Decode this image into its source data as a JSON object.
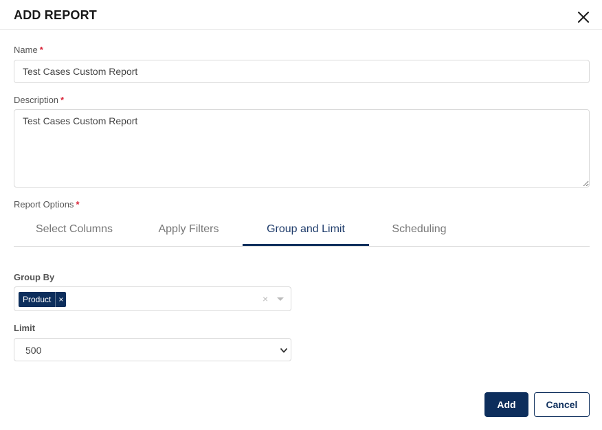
{
  "dialog": {
    "title": "ADD REPORT"
  },
  "form": {
    "name_label": "Name",
    "name_required": "*",
    "name_value": "Test Cases Custom Report",
    "description_label": "Description",
    "description_required": "*",
    "description_value": "Test Cases Custom Report",
    "report_options_label": "Report Options",
    "report_options_required": "*"
  },
  "tabs": [
    {
      "label": "Select Columns",
      "active": false
    },
    {
      "label": "Apply Filters",
      "active": false
    },
    {
      "label": "Group and Limit",
      "active": true
    },
    {
      "label": "Scheduling",
      "active": false
    }
  ],
  "group_by": {
    "label": "Group By",
    "selected": [
      "Product"
    ],
    "remove_glyph": "×",
    "clear_glyph": "×"
  },
  "limit": {
    "label": "Limit",
    "value": "500"
  },
  "buttons": {
    "add": "Add",
    "cancel": "Cancel"
  },
  "colors": {
    "primary": "#0d2e5c",
    "required": "#d9263a",
    "active_tab_text": "#1f3c6b"
  },
  "icons": {
    "close": "close-icon",
    "dropdown": "chevron-down-icon",
    "caret": "caret-down-icon"
  }
}
